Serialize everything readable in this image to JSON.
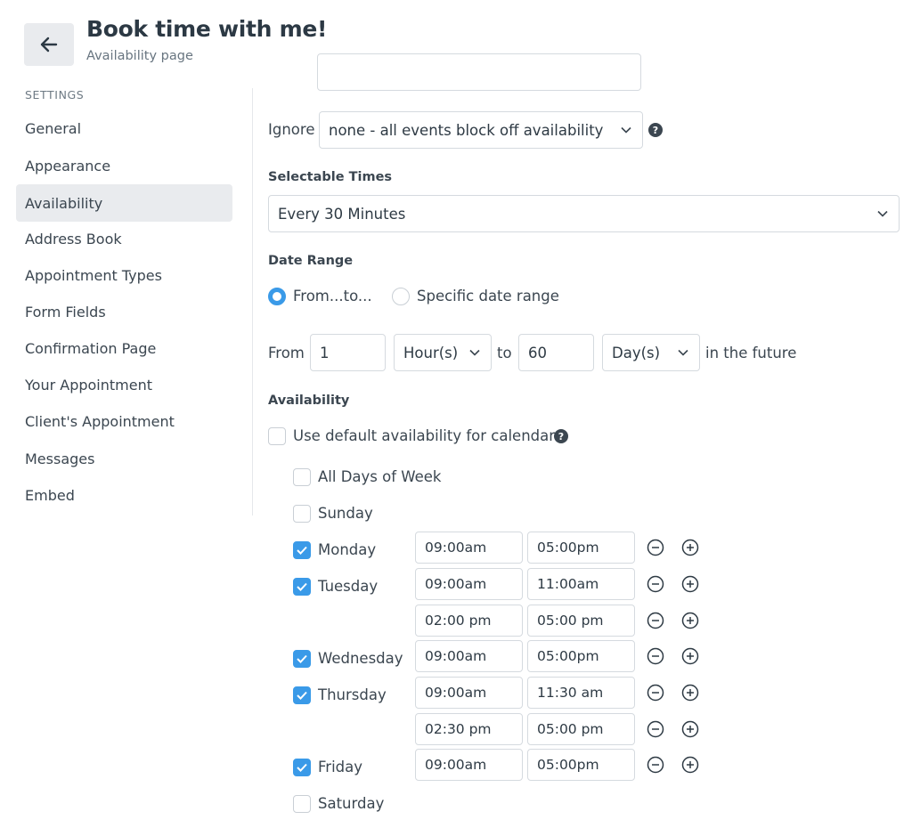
{
  "header": {
    "title": "Book time with me!",
    "subtitle": "Availability page"
  },
  "sidebar": {
    "heading": "SETTINGS",
    "items": [
      {
        "label": "General"
      },
      {
        "label": "Appearance"
      },
      {
        "label": "Availability"
      },
      {
        "label": "Address Book"
      },
      {
        "label": "Appointment Types"
      },
      {
        "label": "Form Fields"
      },
      {
        "label": "Confirmation Page"
      },
      {
        "label": "Your Appointment"
      },
      {
        "label": "Client's Appointment"
      },
      {
        "label": "Messages"
      },
      {
        "label": "Embed"
      }
    ]
  },
  "form": {
    "ignore_label": "Ignore",
    "ignore_value": "none - all events block off availability",
    "selectable_times_label": "Selectable Times",
    "selectable_times_value": "Every 30 Minutes",
    "date_range_label": "Date Range",
    "date_range_option_1": "From...to...",
    "date_range_option_2": "Specific date range",
    "from_label": "From",
    "from_value": "1",
    "from_unit": "Hour(s)",
    "to_label": "to",
    "to_value": "60",
    "to_unit": "Day(s)",
    "future_label": "in the future",
    "availability_label": "Availability",
    "use_default_label": "Use default availability for calendar",
    "all_days_label": "All Days of Week",
    "days": {
      "sunday": "Sunday",
      "monday": "Monday",
      "tuesday": "Tuesday",
      "wednesday": "Wednesday",
      "thursday": "Thursday",
      "friday": "Friday",
      "saturday": "Saturday"
    },
    "times": {
      "monday": [
        {
          "start": "09:00am",
          "end": "05:00pm"
        }
      ],
      "tuesday": [
        {
          "start": "09:00am",
          "end": "11:00am"
        },
        {
          "start": "02:00 pm",
          "end": "05:00 pm"
        }
      ],
      "wednesday": [
        {
          "start": "09:00am",
          "end": "05:00pm"
        }
      ],
      "thursday": [
        {
          "start": "09:00am",
          "end": "11:30 am"
        },
        {
          "start": "02:30 pm",
          "end": "05:00 pm"
        }
      ],
      "friday": [
        {
          "start": "09:00am",
          "end": "05:00pm"
        }
      ]
    }
  },
  "colors": {
    "accent": "#3a9ae8",
    "active_bg": "#e9ebee"
  }
}
